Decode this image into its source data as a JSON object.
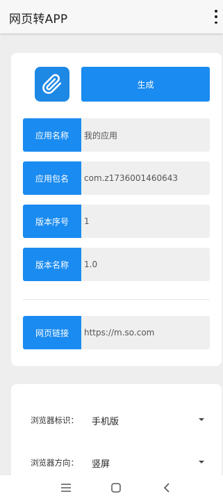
{
  "appbar": {
    "title": "网页转APP",
    "menu_icon": "more-vert-icon"
  },
  "generator": {
    "logo_icon": "attachment-icon",
    "logo_color": "#1e88e5",
    "accent_color": "#1a8bf0",
    "generate_label": "生成"
  },
  "fields": [
    {
      "label": "应用名称",
      "value": "我的应用"
    },
    {
      "label": "应用包名",
      "value": "com.z1736001460643"
    },
    {
      "label": "版本序号",
      "value": "1"
    },
    {
      "label": "版本名称",
      "value": "1.0"
    }
  ],
  "url_field": {
    "label": "网页链接",
    "value": "https://m.so.com"
  },
  "options": [
    {
      "label": "浏览器标识：",
      "value": "手机版"
    },
    {
      "label": "浏览器方向：",
      "value": "竖屏"
    }
  ],
  "navbar": {
    "icons": [
      "menu-icon",
      "home-icon",
      "back-icon"
    ]
  }
}
